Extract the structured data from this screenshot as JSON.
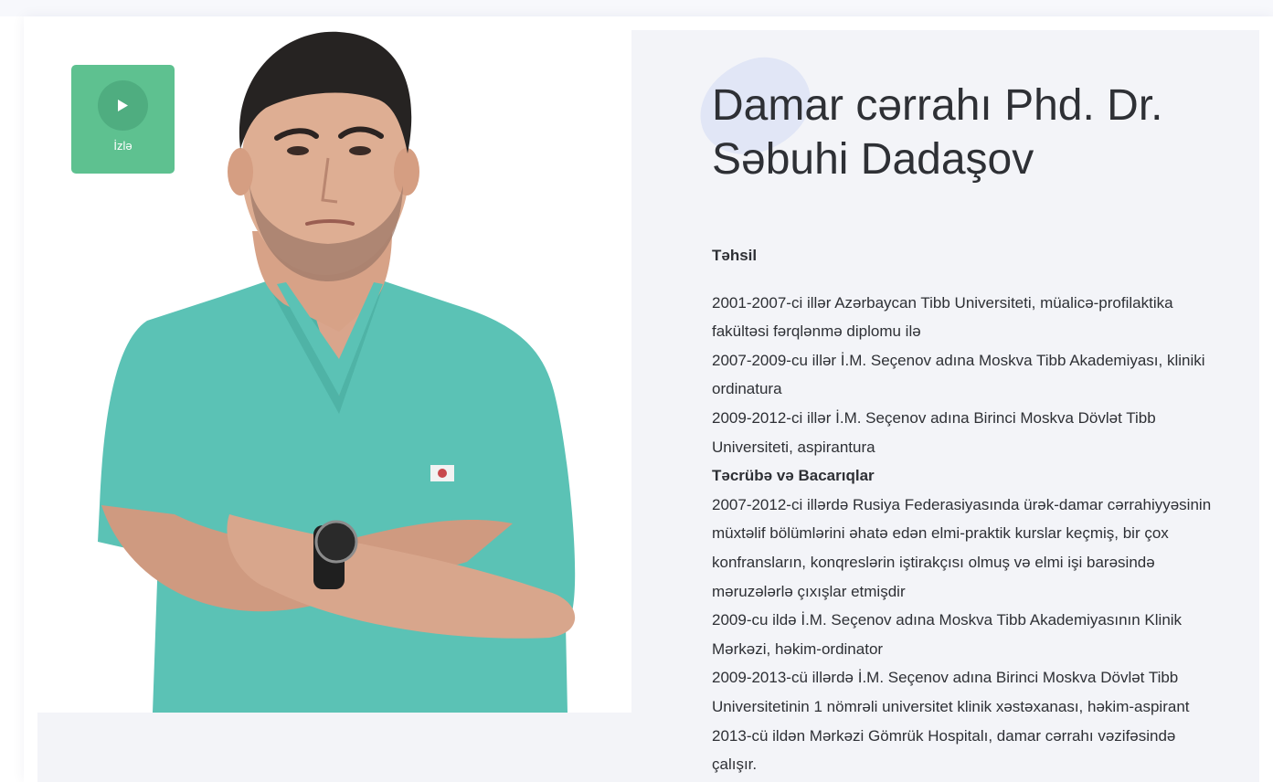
{
  "video_button": {
    "label": "İzlə",
    "icon": "play-icon"
  },
  "doctor": {
    "title": "Damar cərrahı Phd. Dr. Səbuhi Dadaşov"
  },
  "bio": {
    "education_heading": "Təhsil",
    "education": [
      "2001-2007-ci illər Azərbaycan Tibb Universiteti, müalicə-profilaktika fakültəsi fərqlənmə diplomu ilə",
      " 2007-2009-cu illər İ.M. Seçenov adına Moskva Tibb Akademiyası, kliniki ordinatura",
      " 2009-2012-ci illər İ.M. Seçenov adına Birinci Moskva Dövlət Tibb Universiteti, aspirantura"
    ],
    "experience_heading": "Təcrübə və Bacarıqlar",
    "experience": [
      " 2007-2012-ci illərdə Rusiya Federasiyasında ürək-damar cərrahiyyəsinin müxtəlif bölümlərini əhatə edən elmi-praktik kurslar keçmiş, bir çox konfransların, konqreslərin iştirakçısı olmuş və elmi işi barəsində məruzələrlə çıxışlar etmişdir",
      "2009-cu ildə İ.M. Seçenov adına Moskva Tibb Akademiyasının Klinik Mərkəzi, həkim-ordinator",
      "2009-2013-cü illərdə İ.M. Seçenov adına Birinci Moskva Dövlət Tibb Universitetinin 1 nömrəli universitet klinik xəstəxanası, həkim-aspirant",
      "2013-cü ildən Mərkəzi Gömrük Hospitalı, damar cərrahı vəzifəsində çalışır."
    ]
  },
  "colors": {
    "accent_green": "#5ec190",
    "panel_bg": "#f3f4f8",
    "scrubs": "#5bc2b5"
  }
}
